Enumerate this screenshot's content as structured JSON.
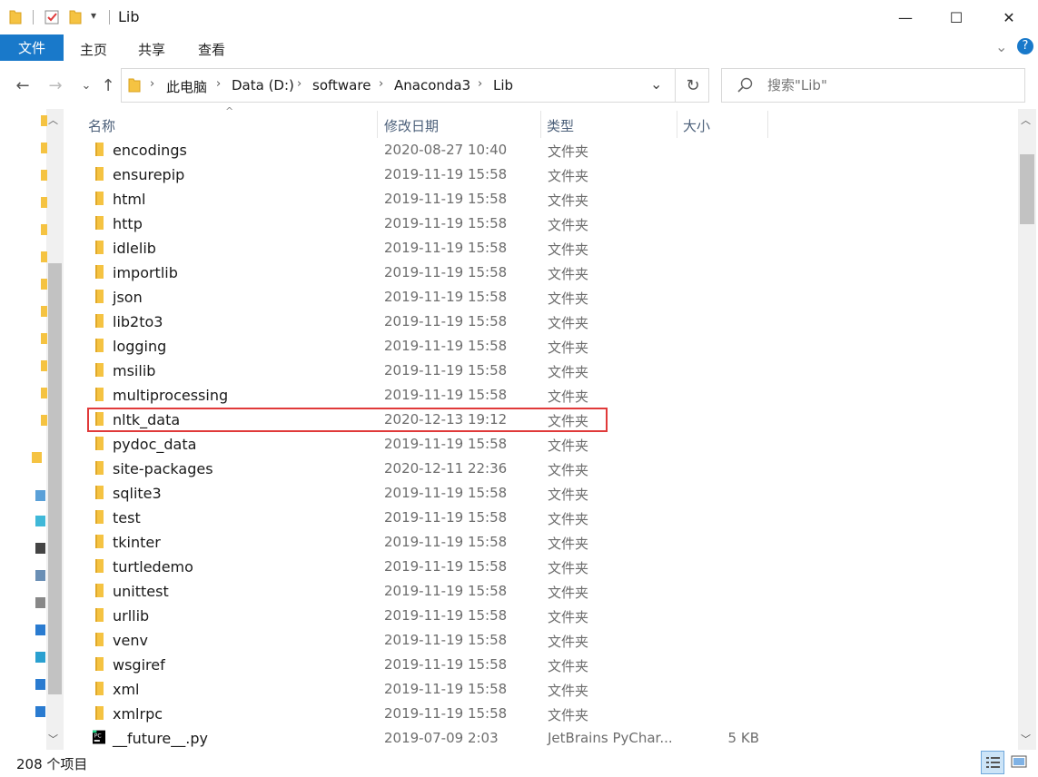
{
  "window": {
    "title": "Lib",
    "minimize": "—",
    "maximize": "☐",
    "close": "✕"
  },
  "ribbon": {
    "file": "文件",
    "home": "主页",
    "share": "共享",
    "view": "查看",
    "expand": "⌄",
    "help": "?"
  },
  "address": {
    "crumbs": [
      "此电脑",
      "Data (D:)",
      "software",
      "Anaconda3",
      "Lib"
    ],
    "dropdown": "⌄",
    "refresh": "↻"
  },
  "search": {
    "placeholder": "搜索\"Lib\""
  },
  "columns": {
    "name": "名称",
    "modified": "修改日期",
    "type": "类型",
    "size": "大小"
  },
  "files": [
    {
      "name": "encodings",
      "date": "2020-08-27 10:40",
      "type": "文件夹",
      "size": ""
    },
    {
      "name": "ensurepip",
      "date": "2019-11-19 15:58",
      "type": "文件夹",
      "size": ""
    },
    {
      "name": "html",
      "date": "2019-11-19 15:58",
      "type": "文件夹",
      "size": ""
    },
    {
      "name": "http",
      "date": "2019-11-19 15:58",
      "type": "文件夹",
      "size": ""
    },
    {
      "name": "idlelib",
      "date": "2019-11-19 15:58",
      "type": "文件夹",
      "size": ""
    },
    {
      "name": "importlib",
      "date": "2019-11-19 15:58",
      "type": "文件夹",
      "size": ""
    },
    {
      "name": "json",
      "date": "2019-11-19 15:58",
      "type": "文件夹",
      "size": ""
    },
    {
      "name": "lib2to3",
      "date": "2019-11-19 15:58",
      "type": "文件夹",
      "size": ""
    },
    {
      "name": "logging",
      "date": "2019-11-19 15:58",
      "type": "文件夹",
      "size": ""
    },
    {
      "name": "msilib",
      "date": "2019-11-19 15:58",
      "type": "文件夹",
      "size": ""
    },
    {
      "name": "multiprocessing",
      "date": "2019-11-19 15:58",
      "type": "文件夹",
      "size": ""
    },
    {
      "name": "nltk_data",
      "date": "2020-12-13 19:12",
      "type": "文件夹",
      "size": ""
    },
    {
      "name": "pydoc_data",
      "date": "2019-11-19 15:58",
      "type": "文件夹",
      "size": ""
    },
    {
      "name": "site-packages",
      "date": "2020-12-11 22:36",
      "type": "文件夹",
      "size": ""
    },
    {
      "name": "sqlite3",
      "date": "2019-11-19 15:58",
      "type": "文件夹",
      "size": ""
    },
    {
      "name": "test",
      "date": "2019-11-19 15:58",
      "type": "文件夹",
      "size": ""
    },
    {
      "name": "tkinter",
      "date": "2019-11-19 15:58",
      "type": "文件夹",
      "size": ""
    },
    {
      "name": "turtledemo",
      "date": "2019-11-19 15:58",
      "type": "文件夹",
      "size": ""
    },
    {
      "name": "unittest",
      "date": "2019-11-19 15:58",
      "type": "文件夹",
      "size": ""
    },
    {
      "name": "urllib",
      "date": "2019-11-19 15:58",
      "type": "文件夹",
      "size": ""
    },
    {
      "name": "venv",
      "date": "2019-11-19 15:58",
      "type": "文件夹",
      "size": ""
    },
    {
      "name": "wsgiref",
      "date": "2019-11-19 15:58",
      "type": "文件夹",
      "size": ""
    },
    {
      "name": "xml",
      "date": "2019-11-19 15:58",
      "type": "文件夹",
      "size": ""
    },
    {
      "name": "xmlrpc",
      "date": "2019-11-19 15:58",
      "type": "文件夹",
      "size": ""
    },
    {
      "name": "__future__.py",
      "date": "2019-07-09 2:03",
      "type": "JetBrains PyChar...",
      "size": "5 KB",
      "icon": "pycharm-icon"
    }
  ],
  "status": {
    "count": "208 个项目"
  },
  "colors": {
    "accent": "#1979ca",
    "folder": "#f5c342",
    "highlight": "#e03a3a"
  }
}
